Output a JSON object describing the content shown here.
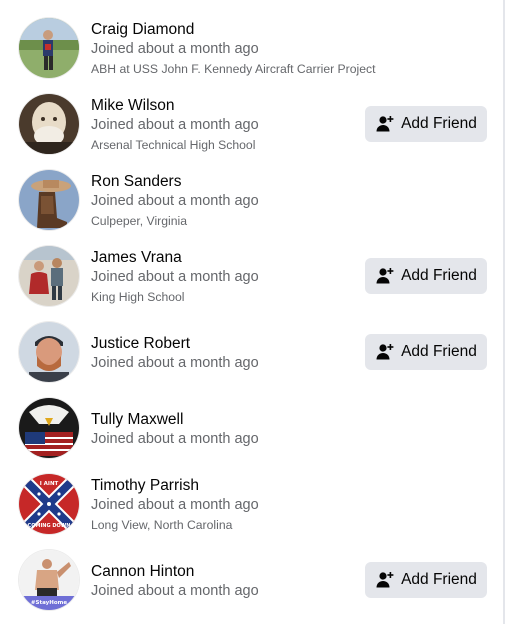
{
  "icons": {
    "add_friend": "person-plus-icon"
  },
  "colors": {
    "button_bg": "#e4e6eb",
    "secondary_text": "#65676b",
    "primary_text": "#050505"
  },
  "people": [
    {
      "name": "Craig Diamond",
      "joined": "Joined about a month ago",
      "detail": "ABH at USS John F. Kennedy Aircraft Carrier Project",
      "button": null
    },
    {
      "name": "Mike Wilson",
      "joined": "Joined about a month ago",
      "detail": "Arsenal Technical High School",
      "button": "Add Friend"
    },
    {
      "name": "Ron Sanders",
      "joined": "Joined about a month ago",
      "detail": "Culpeper, Virginia",
      "button": null
    },
    {
      "name": "James Vrana",
      "joined": "Joined about a month ago",
      "detail": "King High School",
      "button": "Add Friend"
    },
    {
      "name": "Justice Robert",
      "joined": "Joined about a month ago",
      "detail": null,
      "button": "Add Friend"
    },
    {
      "name": "Tully Maxwell",
      "joined": "Joined about a month ago",
      "detail": null,
      "button": null
    },
    {
      "name": "Timothy Parrish",
      "joined": "Joined about a month ago",
      "detail": "Long View, North Carolina",
      "button": null
    },
    {
      "name": "Cannon Hinton",
      "joined": "Joined about a month ago",
      "detail": null,
      "button": "Add Friend"
    }
  ],
  "avatar_texts": {
    "timothy_banner": "I AINT COMING DOWN",
    "cannon_banner": "#StayHome"
  }
}
